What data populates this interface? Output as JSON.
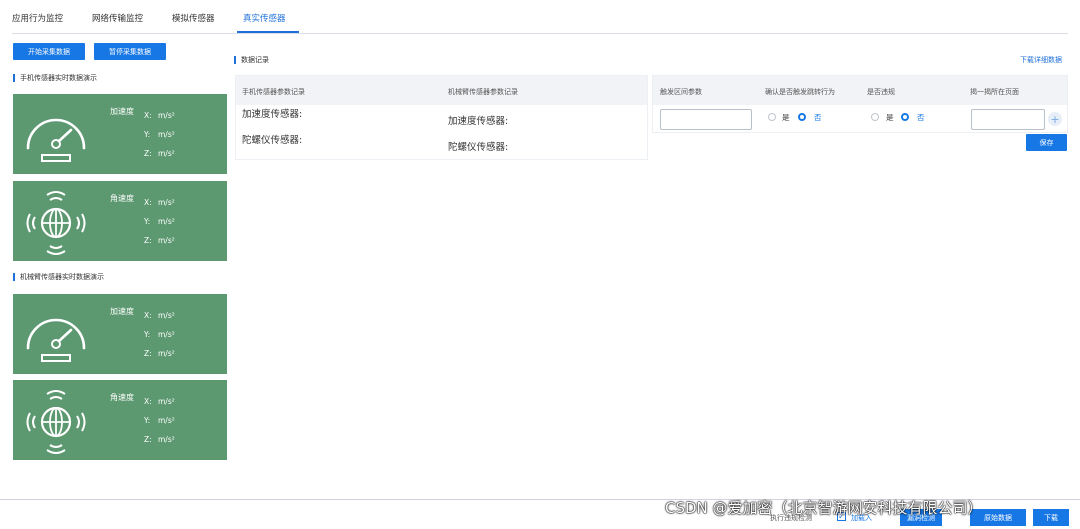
{
  "tabs": [
    {
      "label": "应用行为监控"
    },
    {
      "label": "网络传输监控"
    },
    {
      "label": "模拟传感器"
    },
    {
      "label": "真实传感器",
      "active": true
    }
  ],
  "controls": {
    "start_label": "开始采集数据",
    "pause_label": "暂停采集数据"
  },
  "phone_section": {
    "title": "手机传感器实时数据演示",
    "panels": [
      {
        "type": "加速度",
        "icon": "speedometer-icon",
        "x": "X:",
        "y": "Y:",
        "z": "Z:",
        "unit": "m/s²"
      },
      {
        "type": "角速度",
        "icon": "globe-signal-icon",
        "x": "X:",
        "y": "Y:",
        "z": "Z:",
        "unit": "m/s²"
      }
    ]
  },
  "arm_section": {
    "title": "机械臂传感器实时数据演示",
    "panels": [
      {
        "type": "加速度",
        "icon": "speedometer-icon",
        "x": "X:",
        "y": "Y:",
        "z": "Z:",
        "unit": "m/s²"
      },
      {
        "type": "角速度",
        "icon": "globe-signal-icon",
        "x": "X:",
        "y": "Y:",
        "z": "Z:",
        "unit": "m/s²"
      }
    ]
  },
  "records": {
    "title": "数据记录",
    "download_label": "下载详细数据",
    "headers": [
      "手机传感器参数记录",
      "机械臂传感器参数记录"
    ],
    "phone_rows": [
      "加速度传感器:",
      "陀螺仪传感器:"
    ],
    "arm_rows": [
      "加速度传感器:",
      "陀螺仪传感器:"
    ]
  },
  "config": {
    "headers": [
      "触发区间参数",
      "确认是否触发跳转行为",
      "是否违规",
      "揭一揭所在页面"
    ],
    "yes": "是",
    "no": "否",
    "jump_selected": "否",
    "violation_selected": "否",
    "save_label": "保存"
  },
  "footer": {
    "exec_label": "执行违规检测",
    "join_label": "加载入",
    "btn1": "漏洞检测",
    "btn2": "原始数据",
    "btn3": "下载"
  },
  "watermark": "CSDN @爱加密（北京智游网安科技有限公司）",
  "colors": {
    "accent": "#1677e5",
    "panel": "#5c9870"
  }
}
